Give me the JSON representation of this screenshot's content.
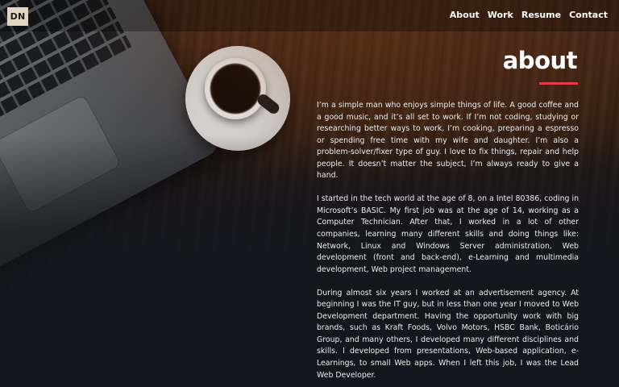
{
  "logo": {
    "text": "DN"
  },
  "nav": [
    {
      "label": "About"
    },
    {
      "label": "Work"
    },
    {
      "label": "Resume"
    },
    {
      "label": "Contact"
    }
  ],
  "section": {
    "title": "about",
    "accent_color": "#e63950",
    "paragraphs": [
      "I’m a simple man who enjoys simple things of life. A good coffee and a good music, and it’s all set to work. If I’m not coding, studying or researching better ways to work, I’m cooking, preparing a espresso or spending free time with my wife and daughter. I’m also a problem-solver/fixer type of guy. I love to fix things, repair and help people. It doesn’t matter the subject, I’m always ready to give a hand.",
      "I started in the tech world at the age of 8, on a Intel 80386, coding in Microsoft’s BASIC. My first job was at the age of 14, working as a Computer Technician. After that, I worked in a lot of other companies, learning many different skills and doing things like: Network, Linux and Windows Server administration, Web development (front and back-end), e-Learning and multimedia development, Web project management.",
      "During almost six years I worked at an advertisement agency. At beginning I was the IT guy, but in less than one year I moved to Web Development department. Having the opportunity work with big brands, such as Kraft Foods, Volvo Motors, HSBC Bank, Boticário Group, and many others, I developed many different disciplines and skills. I developed from presentations, Web-based application, e-Learnings, to small Web apps. When I left this job, I was the Lead Web Developer."
    ]
  },
  "background": {
    "icons": [
      "laptop-image",
      "coffee-cup-image"
    ]
  }
}
